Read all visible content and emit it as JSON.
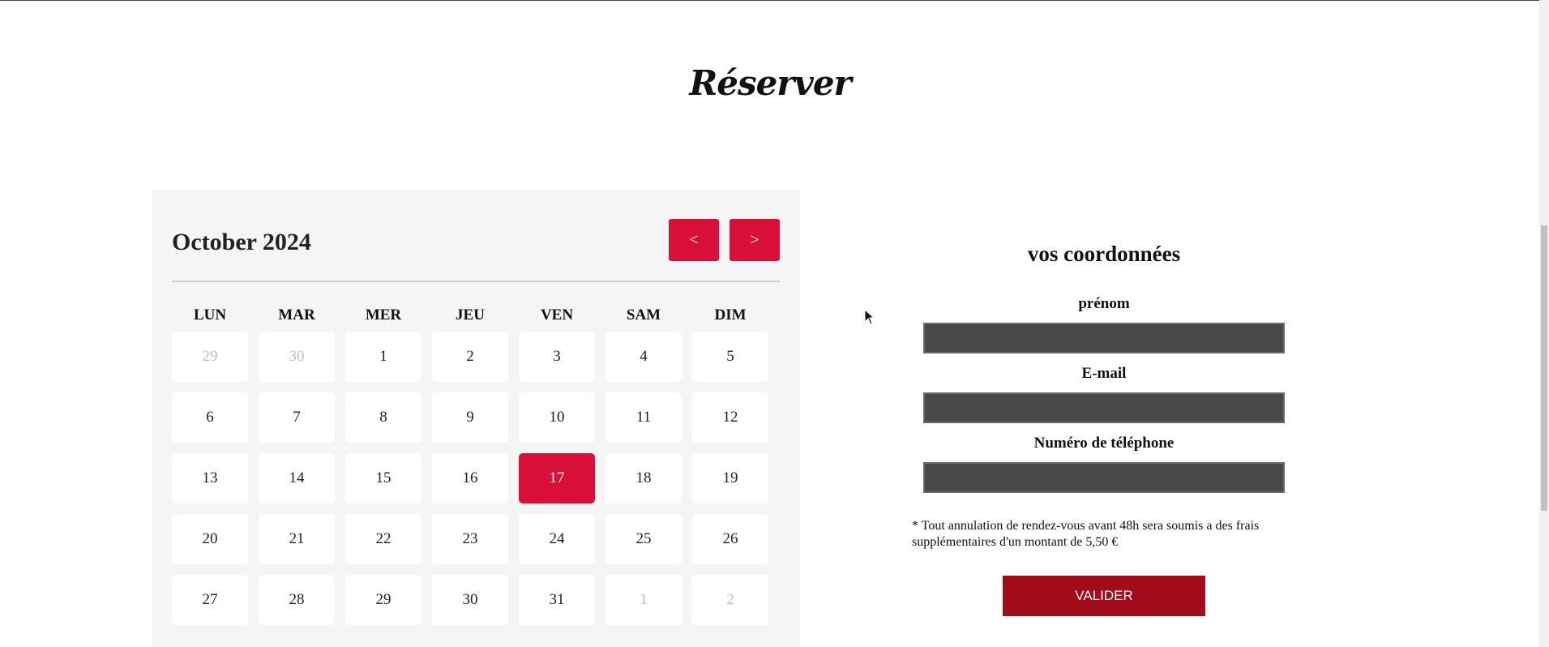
{
  "page": {
    "title": "Réserver"
  },
  "calendar": {
    "month_label": "October 2024",
    "prev_label": "<",
    "next_label": ">",
    "weekdays": [
      "LUN",
      "MAR",
      "MER",
      "JEU",
      "VEN",
      "SAM",
      "DIM"
    ],
    "days": [
      {
        "label": "29",
        "state": "muted"
      },
      {
        "label": "30",
        "state": "muted"
      },
      {
        "label": "1",
        "state": "normal"
      },
      {
        "label": "2",
        "state": "normal"
      },
      {
        "label": "3",
        "state": "normal"
      },
      {
        "label": "4",
        "state": "normal"
      },
      {
        "label": "5",
        "state": "normal"
      },
      {
        "label": "6",
        "state": "normal"
      },
      {
        "label": "7",
        "state": "normal"
      },
      {
        "label": "8",
        "state": "normal"
      },
      {
        "label": "9",
        "state": "normal"
      },
      {
        "label": "10",
        "state": "normal"
      },
      {
        "label": "11",
        "state": "normal"
      },
      {
        "label": "12",
        "state": "normal"
      },
      {
        "label": "13",
        "state": "normal"
      },
      {
        "label": "14",
        "state": "normal"
      },
      {
        "label": "15",
        "state": "normal"
      },
      {
        "label": "16",
        "state": "normal"
      },
      {
        "label": "17",
        "state": "selected"
      },
      {
        "label": "18",
        "state": "normal"
      },
      {
        "label": "19",
        "state": "normal"
      },
      {
        "label": "20",
        "state": "normal"
      },
      {
        "label": "21",
        "state": "normal"
      },
      {
        "label": "22",
        "state": "normal"
      },
      {
        "label": "23",
        "state": "normal"
      },
      {
        "label": "24",
        "state": "normal"
      },
      {
        "label": "25",
        "state": "normal"
      },
      {
        "label": "26",
        "state": "normal"
      },
      {
        "label": "27",
        "state": "normal"
      },
      {
        "label": "28",
        "state": "normal"
      },
      {
        "label": "29",
        "state": "normal"
      },
      {
        "label": "30",
        "state": "normal"
      },
      {
        "label": "31",
        "state": "normal"
      },
      {
        "label": "1",
        "state": "muted"
      },
      {
        "label": "2",
        "state": "muted"
      }
    ]
  },
  "form": {
    "title": "vos coordonnées",
    "prenom_label": "prénom",
    "prenom_value": "",
    "email_label": "E-mail",
    "email_value": "",
    "phone_label": "Numéro de téléphone",
    "phone_value": "",
    "note": "* Tout annulation de rendez-vous avant 48h sera soumis a des frais supplémentaires d'un montant de 5,50 €",
    "submit_label": "VALIDER"
  },
  "colors": {
    "accent": "#d90f3a",
    "submit": "#a10b1a",
    "input_bg": "#484848",
    "calendar_bg": "#f5f5f5"
  }
}
